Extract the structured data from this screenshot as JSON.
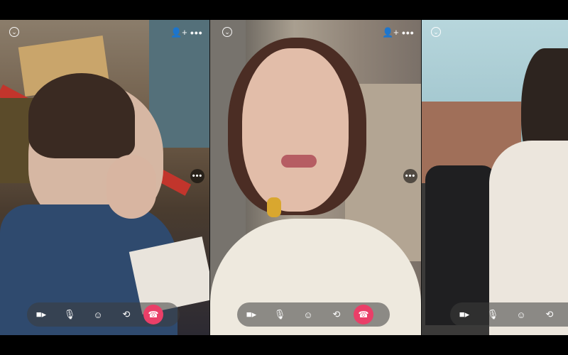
{
  "icons": {
    "collapse": "chevron-down-icon",
    "add_person": "add-person-icon",
    "more": "more-icon",
    "camera": "video-camera-icon",
    "mic": "microphone-icon",
    "effects": "face-effects-icon",
    "flip": "flip-camera-icon",
    "end_call": "end-call-icon"
  },
  "colors": {
    "end_call": "#ea3f68",
    "control_bar": "rgba(60,60,60,0.55)",
    "background": "#000000"
  },
  "panels": [
    {
      "id": "participant-1",
      "has_add_person": true,
      "has_controls": true
    },
    {
      "id": "participant-2",
      "has_add_person": true,
      "has_controls": true
    },
    {
      "id": "participant-3",
      "has_add_person": false,
      "has_controls": true
    }
  ]
}
